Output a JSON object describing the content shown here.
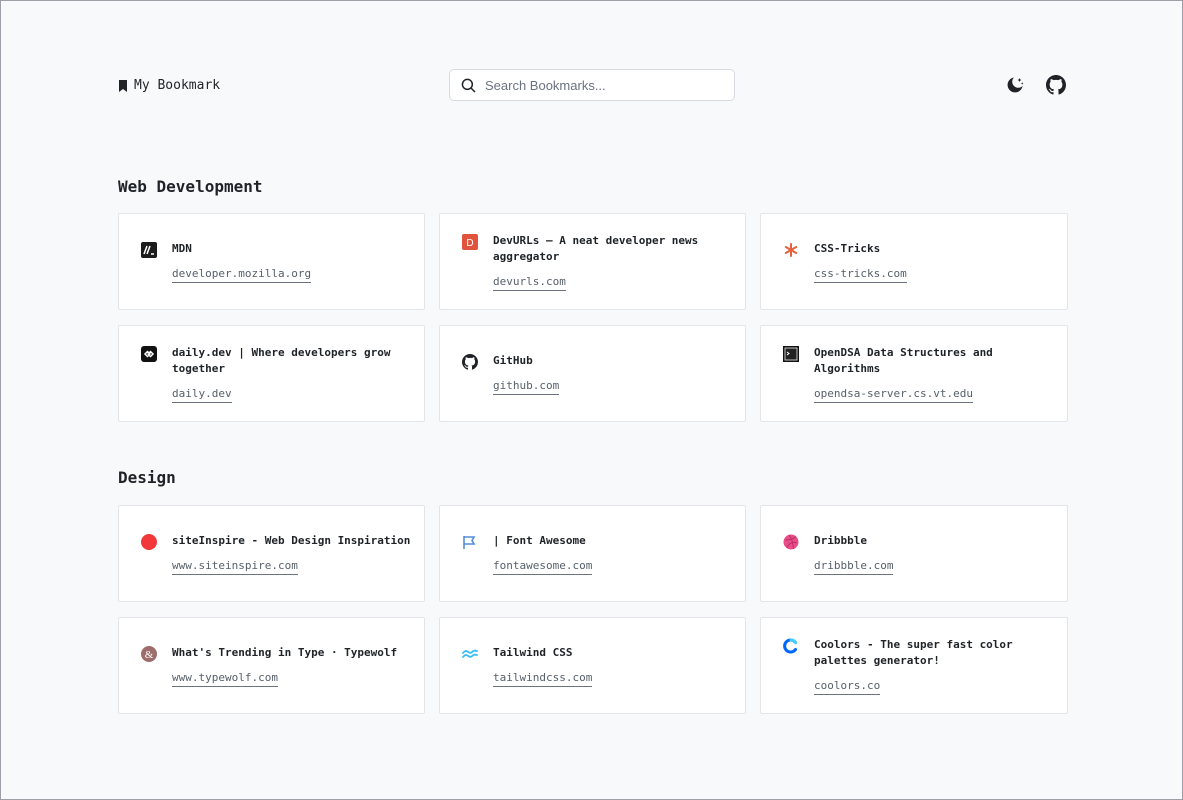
{
  "header": {
    "brand": "My Bookmark",
    "search_placeholder": "Search Bookmarks..."
  },
  "sections": [
    {
      "title": "Web Development",
      "items": [
        {
          "title": "MDN",
          "url": "developer.mozilla.org",
          "icon": "mdn-icon"
        },
        {
          "title": "DevURLs – A neat developer news aggregator",
          "url": "devurls.com",
          "icon": "devurls-icon"
        },
        {
          "title": "CSS-Tricks",
          "url": "css-tricks.com",
          "icon": "css-tricks-icon"
        },
        {
          "title": "daily.dev | Where developers grow together",
          "url": "daily.dev",
          "icon": "daily-dev-icon"
        },
        {
          "title": "GitHub",
          "url": "github.com",
          "icon": "github-icon"
        },
        {
          "title": "OpenDSA Data Structures and Algorithms",
          "url": "opendsa-server.cs.vt.edu",
          "icon": "opendsa-icon"
        }
      ]
    },
    {
      "title": "Design",
      "items": [
        {
          "title": "siteInspire - Web Design Inspiration",
          "url": "www.siteinspire.com",
          "icon": "siteinspire-icon"
        },
        {
          "title": "| Font Awesome",
          "url": "fontawesome.com",
          "icon": "font-awesome-icon"
        },
        {
          "title": "Dribbble",
          "url": "dribbble.com",
          "icon": "dribbble-icon"
        },
        {
          "title": "What's Trending in Type · Typewolf",
          "url": "www.typewolf.com",
          "icon": "typewolf-icon"
        },
        {
          "title": "Tailwind CSS",
          "url": "tailwindcss.com",
          "icon": "tailwind-icon"
        },
        {
          "title": "Coolors - The super fast color palettes generator!",
          "url": "coolors.co",
          "icon": "coolors-icon"
        }
      ]
    }
  ],
  "colors": {
    "background": "#f8f9fb",
    "card_border": "#e3e5e9",
    "text": "#1f2328",
    "devurls": "#e0533c",
    "css_tricks": "#e6603b",
    "siteinspire": "#f2383a",
    "font_awesome": "#538dd7",
    "dribbble": "#ea4c89",
    "typewolf": "#9c6d6a",
    "tailwind": "#38bdf8",
    "coolors": "#0066ff"
  }
}
